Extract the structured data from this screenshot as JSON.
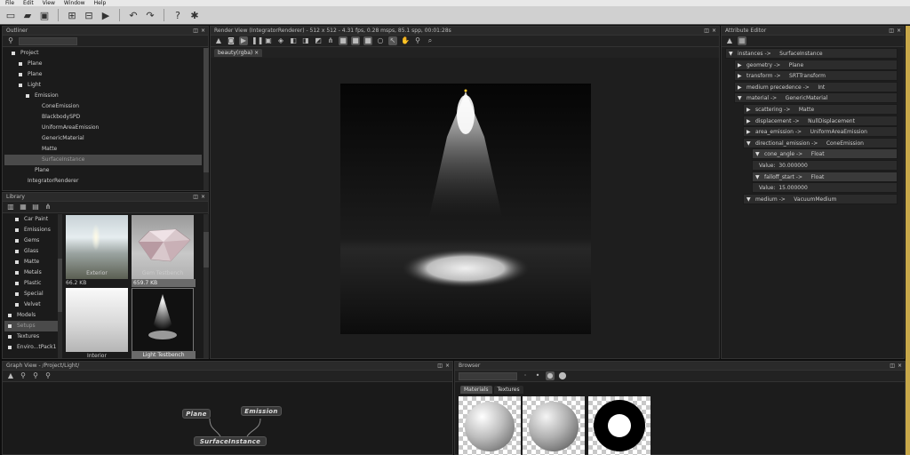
{
  "menu": [
    "File",
    "Edit",
    "View",
    "Window",
    "Help"
  ],
  "toolbar_icons": [
    "new-file-icon",
    "open-folder-icon",
    "save-icon",
    "render-settings-icon",
    "tree-icon",
    "play-icon",
    "undo-icon",
    "redo-icon",
    "help-icon",
    "bug-icon"
  ],
  "outliner": {
    "title": "Outliner",
    "items": [
      {
        "label": "Project",
        "indent": 1,
        "bullet": true
      },
      {
        "label": "Plane",
        "indent": 2,
        "bullet": true
      },
      {
        "label": "Plane",
        "indent": 2,
        "bullet": true
      },
      {
        "label": "Light",
        "indent": 2,
        "bullet": true
      },
      {
        "label": "Emission",
        "indent": 3,
        "bullet": true
      },
      {
        "label": "ConeEmission",
        "indent": 4,
        "bullet": false
      },
      {
        "label": "BlackbodySPD",
        "indent": 4,
        "bullet": false
      },
      {
        "label": "UniformAreaEmission",
        "indent": 4,
        "bullet": false
      },
      {
        "label": "GenericMaterial",
        "indent": 4,
        "bullet": false
      },
      {
        "label": "Matte",
        "indent": 4,
        "bullet": false
      },
      {
        "label": "SurfaceInstance",
        "indent": 4,
        "bullet": false,
        "selected": true
      },
      {
        "label": "Plane",
        "indent": 3,
        "bullet": false
      },
      {
        "label": "IntegratorRenderer",
        "indent": 2,
        "bullet": false
      }
    ]
  },
  "library": {
    "title": "Library",
    "items": [
      {
        "label": "Car Paint",
        "bullet": true
      },
      {
        "label": "Emissions",
        "bullet": true
      },
      {
        "label": "Gems",
        "bullet": true
      },
      {
        "label": "Glass",
        "bullet": true
      },
      {
        "label": "Matte",
        "bullet": true
      },
      {
        "label": "Metals",
        "bullet": true
      },
      {
        "label": "Plastic",
        "bullet": true
      },
      {
        "label": "Special",
        "bullet": true
      },
      {
        "label": "Velvet",
        "bullet": true
      },
      {
        "label": "Models",
        "bullet": true,
        "outdent": true
      },
      {
        "label": "Setups",
        "bullet": true,
        "outdent": true,
        "selected": true
      },
      {
        "label": "Textures",
        "bullet": true,
        "outdent": true
      },
      {
        "label": "Enviro...tPack1",
        "bullet": true,
        "outdent": true
      }
    ],
    "thumbs": [
      {
        "label": "Exterior",
        "size": "66.2 KB"
      },
      {
        "label": "Gem Testbench",
        "size": "659.7 KB"
      },
      {
        "label": "Interior",
        "size": ""
      },
      {
        "label": "Light Testbench",
        "size": ""
      }
    ]
  },
  "render_view": {
    "title": "Render View (IntegratorRenderer) - 512 x 512 - 4.31 fps, 0.28 msps, 85.1 spp, 00:01:28s",
    "tab": "beauty(rgba)"
  },
  "attribute_editor": {
    "title": "Attribute Editor",
    "rows": [
      {
        "arrow": "▼",
        "text": "instances ->     SurfaceInstance",
        "level": 0
      },
      {
        "arrow": "▶",
        "text": "geometry ->     Plane",
        "level": 1
      },
      {
        "arrow": "▶",
        "text": "transform ->     SRTTransform",
        "level": 1
      },
      {
        "arrow": "▶",
        "text": "medium precedence ->     Int",
        "level": 1
      },
      {
        "arrow": "▼",
        "text": "material ->     GenericMaterial",
        "level": 1
      },
      {
        "arrow": "▶",
        "text": "scattering ->     Matte",
        "level": 2
      },
      {
        "arrow": "▶",
        "text": "displacement ->     NullDisplacement",
        "level": 2
      },
      {
        "arrow": "▶",
        "text": "area_emission ->     UniformAreaEmission",
        "level": 2
      },
      {
        "arrow": "▼",
        "text": "directional_emission ->     ConeEmission",
        "level": 2
      },
      {
        "arrow": "▼",
        "text": "cone_angle ->     Float",
        "level": 3,
        "light": true
      },
      {
        "arrow": "",
        "text": "Value:  30.000000",
        "level": 3
      },
      {
        "arrow": "▼",
        "text": "falloff_start ->     Float",
        "level": 3,
        "light": true
      },
      {
        "arrow": "",
        "text": "Value:  15.000000",
        "level": 3
      },
      {
        "arrow": "▼",
        "text": "medium ->     VacuumMedium",
        "level": 2
      }
    ]
  },
  "graph_view": {
    "title": "Graph View - /Project/Light/",
    "nodes": [
      "Plane",
      "Emission",
      "SurfaceInstance"
    ]
  },
  "browser": {
    "title": "Browser",
    "tabs": [
      "Materials",
      "Textures"
    ]
  }
}
